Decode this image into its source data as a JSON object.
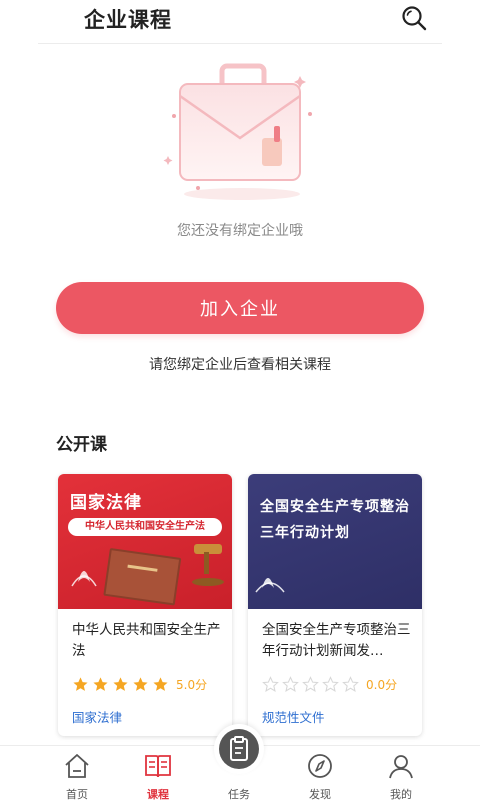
{
  "header": {
    "title": "企业课程",
    "search_icon": "search-icon"
  },
  "empty_state": {
    "illustration_icon": "briefcase-icon",
    "message": "您还没有绑定企业哦",
    "join_button": "加入企业",
    "hint": "请您绑定企业后查看相关课程"
  },
  "public_courses": {
    "section_title": "公开课",
    "cards": [
      {
        "banner_heading": "国家法律",
        "banner_sub": "中华人民共和国安全生产法",
        "title": "中华人民共和国安全生产法",
        "rating": 5.0,
        "score": "5.0分",
        "tag": "国家法律"
      },
      {
        "banner_line1": "全国安全生产专项整治",
        "banner_line2": "三年行动计划",
        "title": "全国安全生产专项整治三年行动计划新闻发…",
        "rating": 0,
        "score": "0.0分",
        "tag": "规范性文件"
      }
    ]
  },
  "bottom_nav": {
    "items": [
      {
        "label": "首页",
        "icon": "home-icon",
        "active": false
      },
      {
        "label": "课程",
        "icon": "book-icon",
        "active": true
      },
      {
        "label": "任务",
        "icon": "task-icon",
        "active": false
      },
      {
        "label": "发现",
        "icon": "compass-icon",
        "active": false
      },
      {
        "label": "我的",
        "icon": "user-icon",
        "active": false
      }
    ]
  },
  "colors": {
    "accent": "#ec5763",
    "active_nav": "#e0343f",
    "star_filled": "#f5a623",
    "star_empty": "#d8d8d8",
    "tag_link": "#2f6fd0"
  }
}
